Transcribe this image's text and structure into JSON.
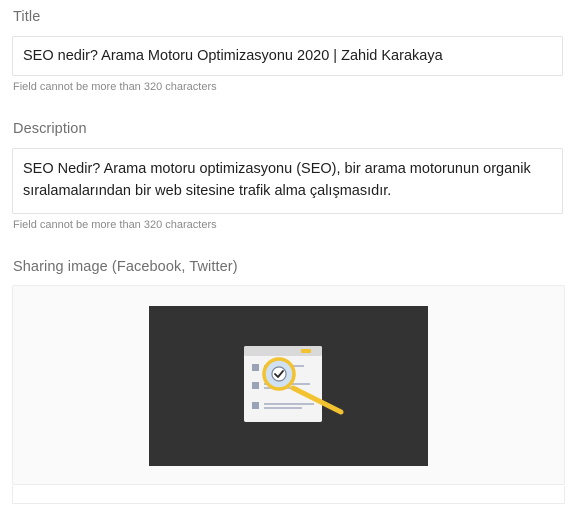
{
  "title_section": {
    "label": "Title",
    "value": "SEO nedir? Arama Motoru Optimizasyonu 2020 | Zahid Karakaya",
    "helper": "Field cannot be more than 320 characters"
  },
  "description_section": {
    "label": "Description",
    "value": "SEO Nedir? Arama motoru optimizasyonu (SEO), bir arama motorunun organik sıralamalarından bir web sitesine trafik alma çalışmasıdır.",
    "helper": "Field cannot be more than 320 characters"
  },
  "image_section": {
    "label": "Sharing image (Facebook, Twitter)",
    "image_icon": "seo-magnifier-checklist-icon",
    "image_background": "#333333"
  }
}
